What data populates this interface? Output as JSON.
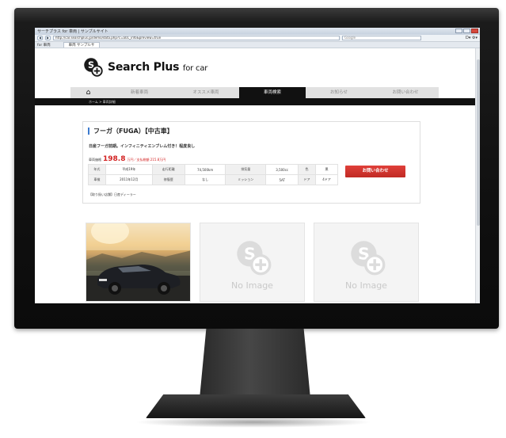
{
  "browser": {
    "window_title": "サーチプラス for 車両 | サンプルサイト",
    "address": "http://car.searchplus.jp/demo/data.php?c=a01_info&preview=true",
    "search_placeholder": "Google",
    "tabs": [
      "for 車両",
      "車両 サンプルサ"
    ],
    "tools_label": "D▾ ⚙▾"
  },
  "site": {
    "logo_text": "Search Plus",
    "logo_sub": "for car",
    "nav": [
      "新着車両",
      "オススメ車両",
      "車両検索",
      "お知らせ",
      "お問い合わせ"
    ],
    "nav_active": "車両検索",
    "breadcrumb": "ホーム > 車両詳細"
  },
  "listing": {
    "title": "フーガ（FUGA）【中古車】",
    "description": "日産フーガ前期。インフィニティエンブレム付き！程度良し",
    "price_label": "車両価格",
    "price": "198.8",
    "price_unit": "万円／支払総額 215.8万円",
    "specs": [
      [
        "年式",
        "平成19年",
        "走行距離",
        "74,500km",
        "排気量",
        "3,500cc",
        "色",
        "黒"
      ],
      [
        "車検",
        "2011年12月",
        "修復歴",
        "なし",
        "ミッション",
        "5AT",
        "ドア",
        "4ドア"
      ]
    ],
    "dealer": "【取り扱い店舗】日産ディーラー",
    "inquiry_label": "お問い合わせ"
  },
  "gallery": {
    "noimage_label": "No Image"
  },
  "colors": {
    "accent_red": "#d32222",
    "button_red": "#d0352f",
    "title_bar_blue": "#3d7bcf",
    "nav_dark": "#111111"
  }
}
